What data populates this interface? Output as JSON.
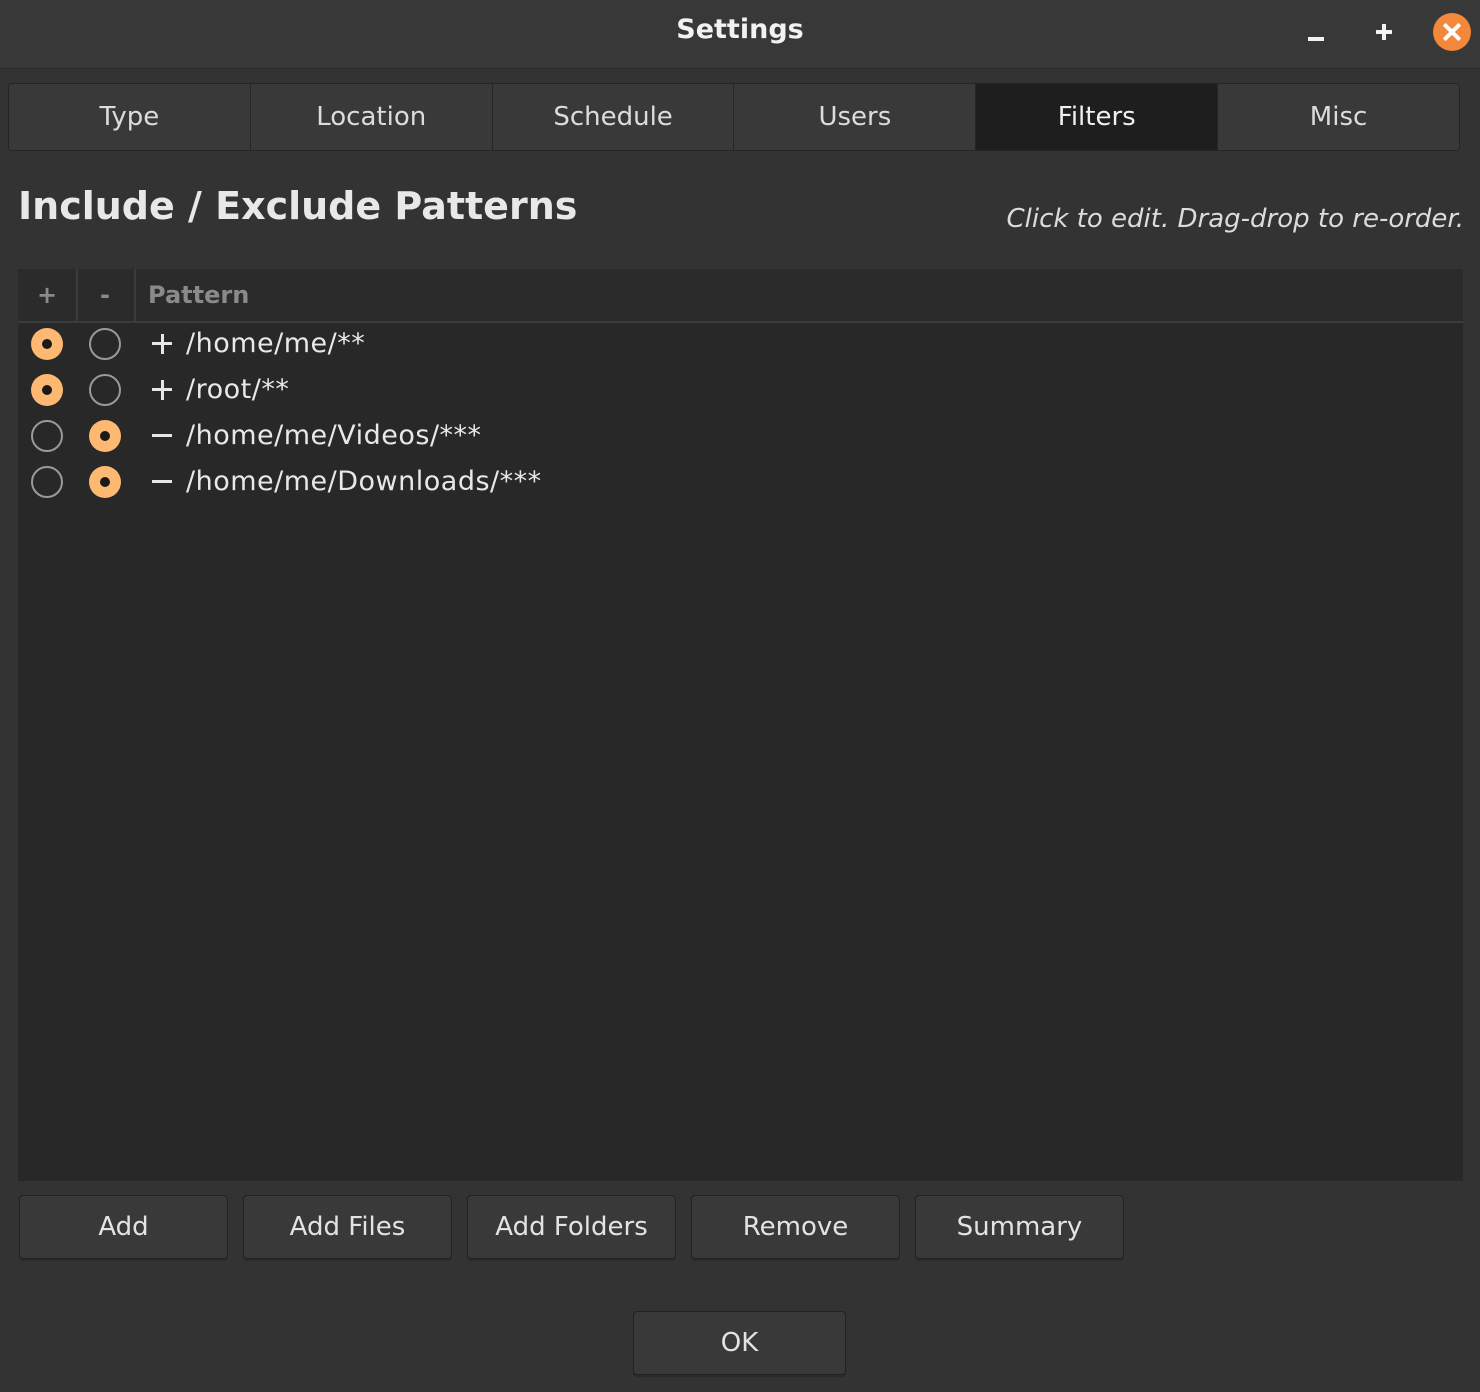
{
  "window": {
    "title": "Settings",
    "controls": [
      "minimize",
      "maximize",
      "close"
    ],
    "accent_color": "#f4883a"
  },
  "tabs": [
    {
      "label": "Type",
      "active": false
    },
    {
      "label": "Location",
      "active": false
    },
    {
      "label": "Schedule",
      "active": false
    },
    {
      "label": "Users",
      "active": false
    },
    {
      "label": "Filters",
      "active": true
    },
    {
      "label": "Misc",
      "active": false
    }
  ],
  "filters": {
    "heading": "Include / Exclude Patterns",
    "hint": "Click to edit. Drag-drop to re-order.",
    "columns": {
      "include": "+",
      "exclude": "-",
      "pattern": "Pattern"
    },
    "rows": [
      {
        "mode": "include",
        "sign": "plus-icon",
        "pattern": "/home/me/**"
      },
      {
        "mode": "include",
        "sign": "plus-icon",
        "pattern": "/root/**"
      },
      {
        "mode": "exclude",
        "sign": "minus-icon",
        "pattern": "/home/me/Videos/***"
      },
      {
        "mode": "exclude",
        "sign": "minus-icon",
        "pattern": "/home/me/Downloads/***"
      }
    ],
    "radio_on_color": "#fdb871"
  },
  "actions": {
    "add": "Add",
    "add_files": "Add Files",
    "add_folders": "Add Folders",
    "remove": "Remove",
    "summary": "Summary"
  },
  "footer": {
    "ok": "OK"
  }
}
